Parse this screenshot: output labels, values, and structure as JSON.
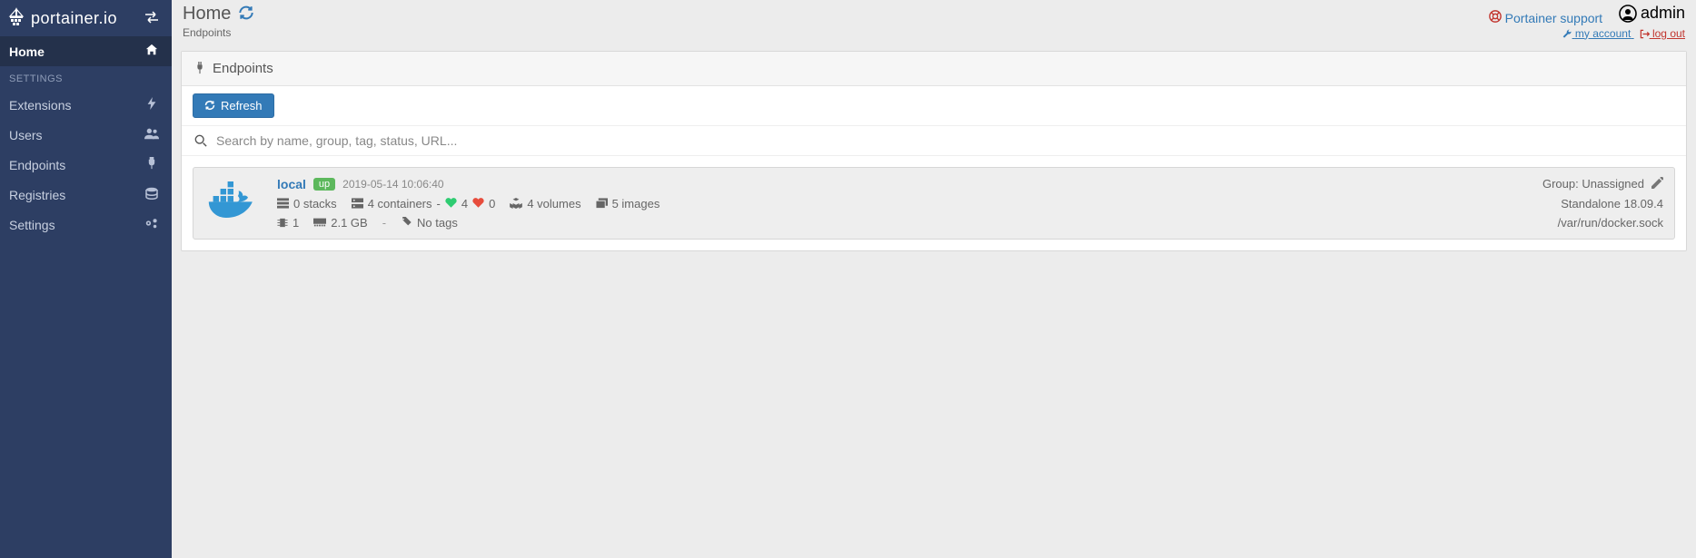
{
  "brand": "portainer.io",
  "sidebar": {
    "home": "Home",
    "section": "SETTINGS",
    "items": [
      {
        "label": "Extensions"
      },
      {
        "label": "Users"
      },
      {
        "label": "Endpoints"
      },
      {
        "label": "Registries"
      },
      {
        "label": "Settings"
      }
    ]
  },
  "header": {
    "title": "Home",
    "subtitle": "Endpoints",
    "support_label": "Portainer support",
    "user": "admin",
    "my_account": "my account",
    "log_out": "log out"
  },
  "panel": {
    "title": "Endpoints",
    "refresh": "Refresh",
    "search_placeholder": "Search by name, group, tag, status, URL..."
  },
  "endpoint": {
    "name": "local",
    "status": "up",
    "timestamp": "2019-05-14 10:06:40",
    "stacks": "0 stacks",
    "containers": "4 containers",
    "healthy": "4",
    "unhealthy": "0",
    "volumes": "4 volumes",
    "images": "5 images",
    "cpu": "1",
    "ram": "2.1 GB",
    "tags": "No tags",
    "group": "Group: Unassigned",
    "engine": "Standalone 18.09.4",
    "socket": "/var/run/docker.sock"
  }
}
